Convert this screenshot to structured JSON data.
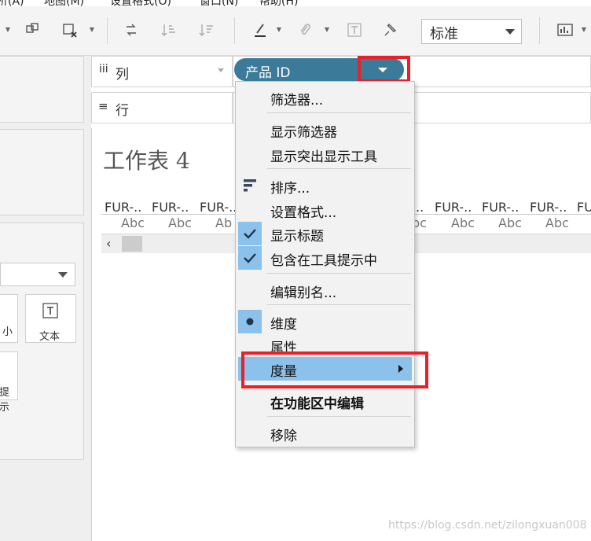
{
  "menubar": {
    "items": [
      "析(A)",
      "地图(M)",
      "设置格式(O)",
      "窗口(N)",
      "帮助(H)"
    ]
  },
  "toolbar": {
    "fit_value": "标准",
    "icons": [
      "swap-rows-icon",
      "chart-remove-icon",
      "refresh-swap-icon",
      "sort-ascending-icon",
      "sort-descending-icon",
      "highlighter-icon",
      "paperclip-icon",
      "label-icon",
      "pin-icon",
      "show-me-icon"
    ]
  },
  "shelves": {
    "columns": {
      "icon": "iii",
      "label": "列"
    },
    "rows": {
      "icon": "≡",
      "label": "行"
    },
    "pill": {
      "label": "产品 ID"
    }
  },
  "marks": {
    "text_button": "文本",
    "partial_buttons": [
      "小",
      "提示"
    ]
  },
  "sheet": {
    "title": "工作表 4",
    "column_headers": [
      "FUR-..",
      "FUR-..",
      "FUR-..",
      "..",
      "FUR-..",
      "FUR-..",
      "FUR-..",
      "FU"
    ],
    "cell_text": [
      "Abc",
      "Abc",
      "Ab",
      "bc",
      "Abc",
      "Abc",
      "Abc"
    ]
  },
  "context_menu": {
    "items": [
      {
        "label": "筛选器...",
        "icon": "",
        "checked": false
      },
      {
        "label": "显示筛选器",
        "icon": "",
        "checked": false
      },
      {
        "label": "显示突出显示工具",
        "icon": "",
        "checked": false
      },
      {
        "label": "排序...",
        "icon": "sort-icon",
        "checked": false
      },
      {
        "label": "设置格式...",
        "icon": "",
        "checked": false
      },
      {
        "label": "显示标题",
        "icon": "checkmark-icon",
        "checked": true
      },
      {
        "label": "包含在工具提示中",
        "icon": "checkmark-icon",
        "checked": true
      },
      {
        "label": "编辑别名...",
        "icon": "",
        "checked": false
      },
      {
        "label": "维度",
        "icon": "bullet-icon",
        "checked": true
      },
      {
        "label": "属性",
        "icon": "",
        "checked": false
      },
      {
        "label": "度量",
        "icon": "submenu-arrow-icon",
        "checked": false,
        "highlighted": true
      },
      {
        "label": "在功能区中编辑",
        "icon": "",
        "checked": false,
        "bold": true
      },
      {
        "label": "移除",
        "icon": "",
        "checked": false
      }
    ]
  },
  "colors": {
    "pill": "#3b7b99",
    "highlight": "#8cc1eb",
    "annotation_red": "#e8202a"
  },
  "watermark": "https://blog.csdn.net/zilongxuan008"
}
